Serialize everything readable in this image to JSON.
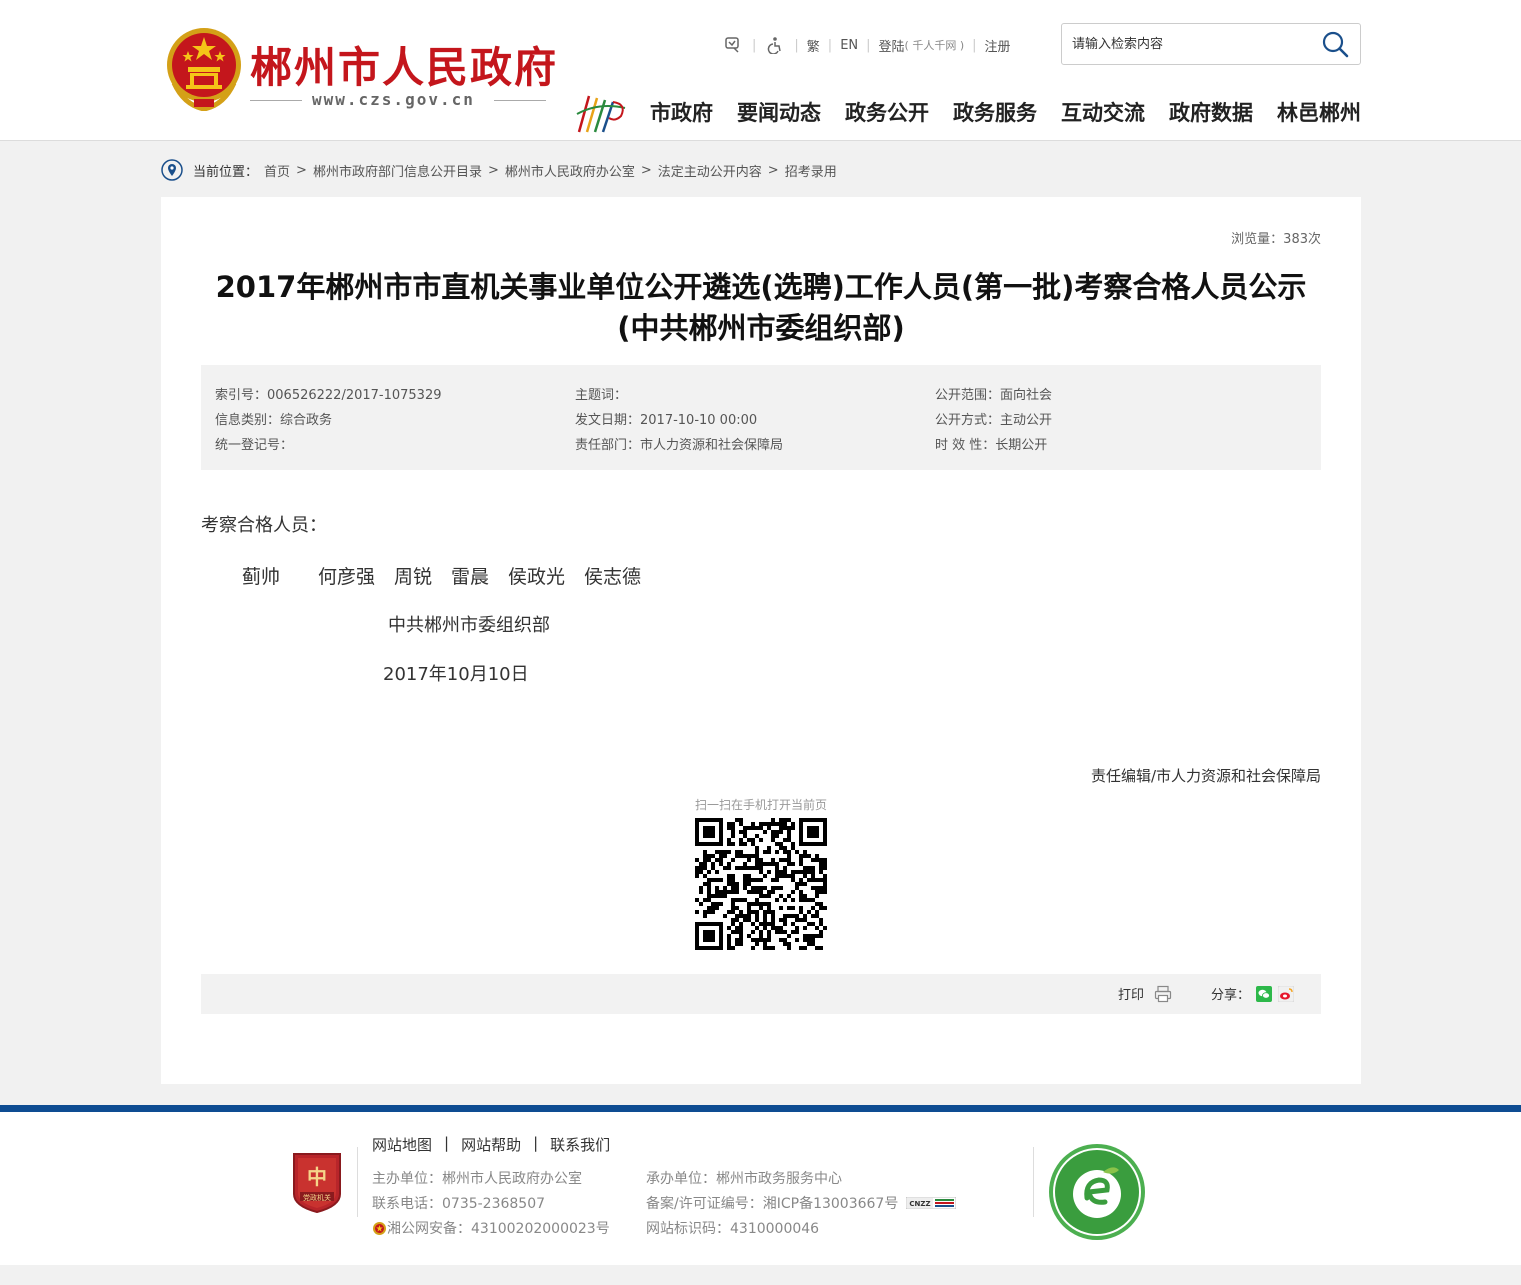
{
  "header": {
    "site_name": "郴州市人民政府",
    "site_url": "www.czs.gov.cn",
    "top_links": {
      "traditional": "繁",
      "english": "EN",
      "login": "登陆",
      "login_sub": "( 千人千网 )",
      "register": "注册"
    },
    "search_placeholder": "请输入检索内容",
    "nav": [
      "市政府",
      "要闻动态",
      "政务公开",
      "政务服务",
      "互动交流",
      "政府数据",
      "林邑郴州"
    ]
  },
  "breadcrumb": {
    "lead": "当前位置：",
    "items": [
      "首页",
      "郴州市政府部门信息公开目录",
      "郴州市人民政府办公室",
      "法定主动公开内容",
      "招考录用"
    ]
  },
  "article": {
    "views": "浏览量：383次",
    "title_line1": "2017年郴州市市直机关事业单位公开遴选(选聘)工作人员(第一批)考察合格人员公示",
    "title_line2": "(中共郴州市委组织部)",
    "meta": {
      "index_no": "索引号：006526222/2017-1075329",
      "category": "信息类别：综合政务",
      "reg_no": "统一登记号：",
      "keywords": "主题词：",
      "date": "发文日期：2017-10-10 00:00",
      "department": "责任部门：市人力资源和社会保障局",
      "scope": "公开范围：面向社会",
      "method": "公开方式：主动公开",
      "validity": "时 效 性：长期公开"
    },
    "intro": "考察合格人员：",
    "names": "蓟帅　　何彦强　周锐　雷晨　侯政光　侯志德",
    "org": "中共郴州市委组织部",
    "sign_date": "2017年10月10日",
    "editor": "责任编辑/市人力资源和社会保障局",
    "qr_caption": "扫一扫在手机打开当前页",
    "print_label": "打印",
    "share_label": "分享："
  },
  "footer": {
    "links": [
      "网站地图",
      "网站帮助",
      "联系我们"
    ],
    "sponsor": "主办单位：郴州市人民政府办公室",
    "phone": "联系电话：0735-2368507",
    "police": "湘公网安备：43100202000023号",
    "organizer": "承办单位：郴州市政务服务中心",
    "icp": "备案/许可证编号：湘ICP备13003667号",
    "site_code": "网站标识码：4310000046"
  },
  "colors": {
    "brand_red": "#c4161c",
    "footer_blue": "#0e4c92",
    "meta_bg": "#f2f2f2"
  }
}
